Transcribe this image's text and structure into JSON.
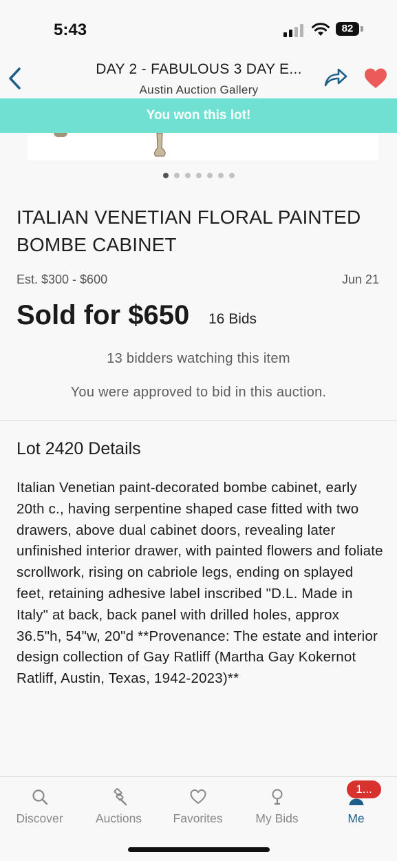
{
  "status": {
    "time": "5:43",
    "battery": "82"
  },
  "header": {
    "title": "DAY 2 - FABULOUS 3 DAY E...",
    "subtitle": "Austin Auction Gallery",
    "accent_color": "#1e5f8a",
    "favorite_color": "#ec5a5a"
  },
  "banner": {
    "text": "You won this lot!",
    "color": "#6fe0d2"
  },
  "gallery": {
    "image_count": 7,
    "active_index": 0
  },
  "lot": {
    "title": "ITALIAN VENETIAN FLORAL PAINTED BOMBE CABINET",
    "estimate": "Est. $300 - $600",
    "date": "Jun 21",
    "sold_price": "Sold for $650",
    "bids": "16 Bids",
    "watchers": "13 bidders watching this item",
    "approval": "You were approved to bid in this auction."
  },
  "details": {
    "heading": "Lot 2420 Details",
    "description": "Italian Venetian paint-decorated bombe cabinet, early 20th c., having serpentine shaped case fitted with two drawers, above dual cabinet doors, revealing later unfinished interior drawer, with painted flowers and foliate scrollwork, rising on cabriole legs, ending on splayed feet, retaining adhesive label inscribed \"D.L. Made in Italy\" at back, back panel with drilled holes, approx 36.5\"h, 54\"w, 20\"d **Provenance: The estate and interior design collection of Gay Ratliff (Martha Gay Kokernot Ratliff, Austin, Texas, 1942-2023)**"
  },
  "tabs": [
    {
      "label": "Discover",
      "icon": "search-icon"
    },
    {
      "label": "Auctions",
      "icon": "gavel-icon"
    },
    {
      "label": "Favorites",
      "icon": "heart-icon"
    },
    {
      "label": "My Bids",
      "icon": "paddle-icon"
    },
    {
      "label": "Me",
      "icon": "person-icon",
      "badge": "1...",
      "active": true
    }
  ]
}
